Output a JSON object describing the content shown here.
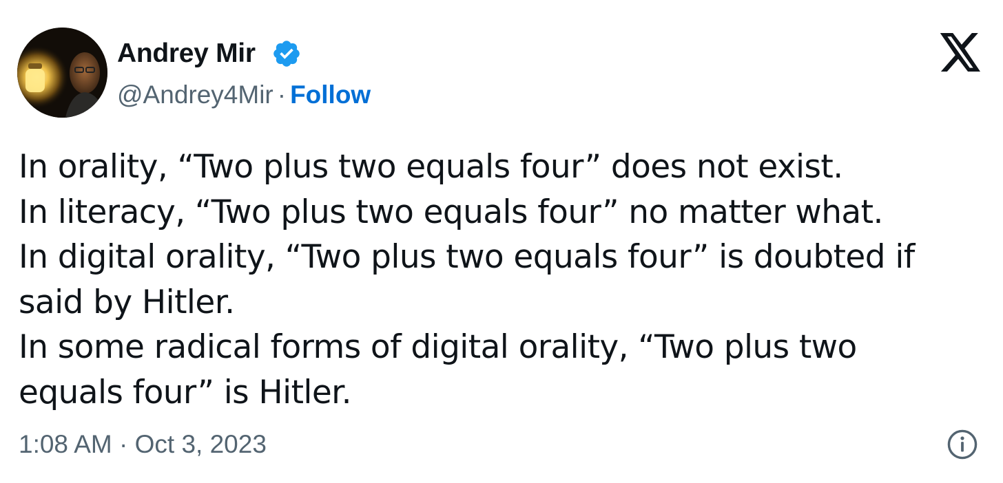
{
  "author": {
    "name": "Andrey Mir",
    "handle": "@Andrey4Mir",
    "separator": "·",
    "follow_label": "Follow",
    "verified": true
  },
  "brand": {
    "logo": "x-logo-icon",
    "verified_color": "#1d9bf0",
    "link_color": "#006fd6",
    "secondary_text_color": "#536471"
  },
  "tweet": {
    "lines": [
      "In orality, “Two plus two equals four” does not exist.",
      "In literacy, “Two plus two equals four” no matter what.",
      "In digital orality, “Two plus two equals four” is doubted if",
      "said by Hitler.",
      "In some radical forms of digital orality, “Two plus two",
      "equals four” is Hitler."
    ],
    "timestamp": "1:08 AM · Oct 3, 2023"
  },
  "icons": {
    "verified": "verified-badge-icon",
    "close_logo": "x-logo-icon",
    "info": "info-icon"
  }
}
